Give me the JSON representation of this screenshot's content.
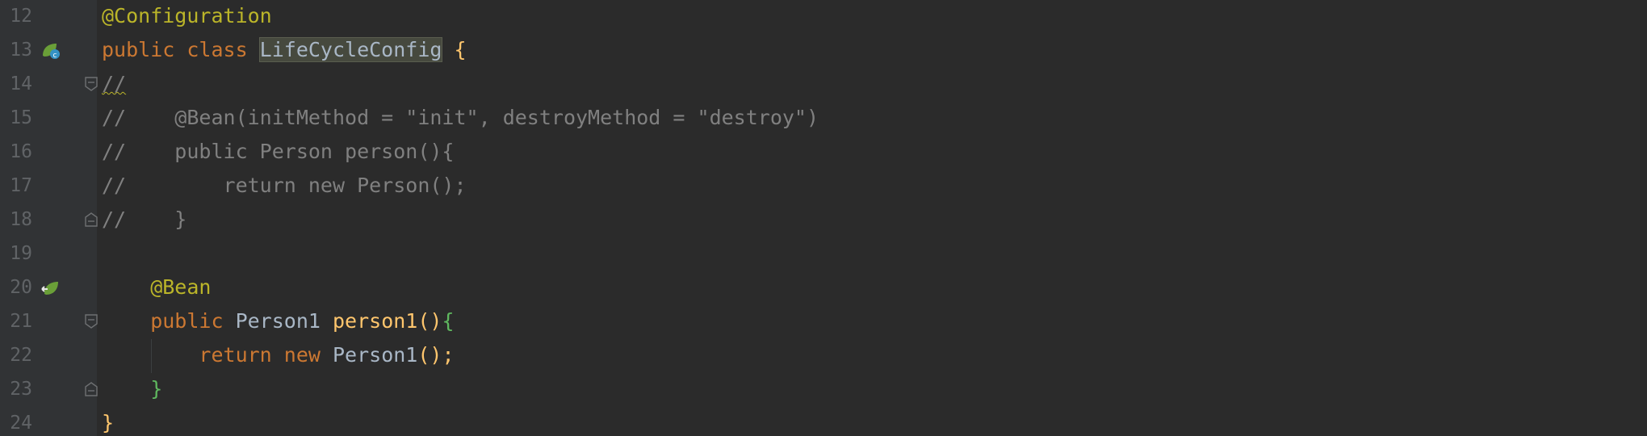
{
  "editor": {
    "lines": [
      {
        "num": "12",
        "tokens": [
          {
            "t": "@Configuration",
            "c": "ann"
          }
        ]
      },
      {
        "num": "13",
        "tokens": [
          {
            "t": "public ",
            "c": "kw"
          },
          {
            "t": "class ",
            "c": "kw"
          },
          {
            "t": "LifeCycleConfig",
            "c": "cls highlight"
          },
          {
            "t": " ",
            "c": ""
          },
          {
            "t": "{",
            "c": "brace-y"
          }
        ]
      },
      {
        "num": "14",
        "tokens": [
          {
            "t": "//",
            "c": "cmt squiggle"
          }
        ]
      },
      {
        "num": "15",
        "tokens": [
          {
            "t": "//    @Bean(initMethod = \"init\", destroyMethod = \"destroy\")",
            "c": "cmt"
          }
        ]
      },
      {
        "num": "16",
        "tokens": [
          {
            "t": "//    public Person person(){",
            "c": "cmt"
          }
        ]
      },
      {
        "num": "17",
        "tokens": [
          {
            "t": "//        return new Person();",
            "c": "cmt"
          }
        ]
      },
      {
        "num": "18",
        "tokens": [
          {
            "t": "//    }",
            "c": "cmt"
          }
        ]
      },
      {
        "num": "19",
        "tokens": []
      },
      {
        "num": "20",
        "tokens": [
          {
            "t": "    @Bean",
            "c": "ann"
          }
        ]
      },
      {
        "num": "21",
        "tokens": [
          {
            "t": "    public ",
            "c": "kw"
          },
          {
            "t": "Person1 ",
            "c": "cls"
          },
          {
            "t": "person1",
            "c": "fn"
          },
          {
            "t": "()",
            "c": "paren-y"
          },
          {
            "t": "{",
            "c": "brace-g"
          }
        ]
      },
      {
        "num": "22",
        "tokens": [
          {
            "t": "        return ",
            "c": "kw"
          },
          {
            "t": "new ",
            "c": "kw"
          },
          {
            "t": "Person1",
            "c": "cls"
          },
          {
            "t": "();",
            "c": "paren-y"
          }
        ]
      },
      {
        "num": "23",
        "tokens": [
          {
            "t": "    }",
            "c": "brace-g"
          }
        ]
      },
      {
        "num": "24",
        "tokens": [
          {
            "t": "}",
            "c": "brace-y"
          }
        ]
      }
    ],
    "gutter_icons": {
      "13": "spring-bean-config-icon",
      "20": "spring-bean-navigate-icon"
    },
    "fold_markers": {
      "14": "fold-start",
      "18": "fold-end",
      "21": "fold-start",
      "23": "fold-end"
    },
    "colors": {
      "background": "#2b2b2b",
      "gutter": "#313335",
      "keyword": "#cc7832",
      "annotation": "#bbb529",
      "comment": "#808080",
      "method": "#ffc66d",
      "text": "#a9b7c6",
      "bracket_green": "#5fb85f"
    }
  }
}
